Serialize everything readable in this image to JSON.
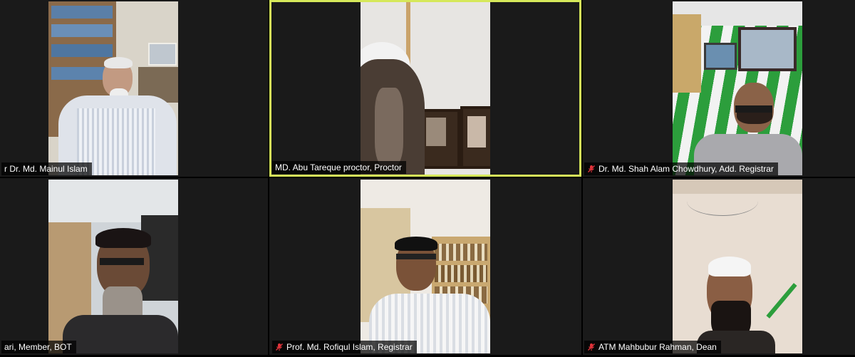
{
  "participants": [
    {
      "name": "r Dr. Md. Mainul Islam",
      "muted": false,
      "active": false
    },
    {
      "name": "MD. Abu Tareque proctor, Proctor",
      "muted": false,
      "active": true
    },
    {
      "name": "Dr. Md. Shah Alam Chowdhury, Add. Registrar",
      "muted": true,
      "active": false
    },
    {
      "name": "ari, Member, BOT",
      "muted": false,
      "active": false
    },
    {
      "name": "Prof. Md. Rofiqul Islam, Registrar",
      "muted": true,
      "active": false
    },
    {
      "name": "ATM Mahbubur Rahman, Dean",
      "muted": true,
      "active": false
    }
  ],
  "colors": {
    "active_border": "#d6e85a",
    "muted_icon": "#e0333a",
    "background": "#000000"
  }
}
